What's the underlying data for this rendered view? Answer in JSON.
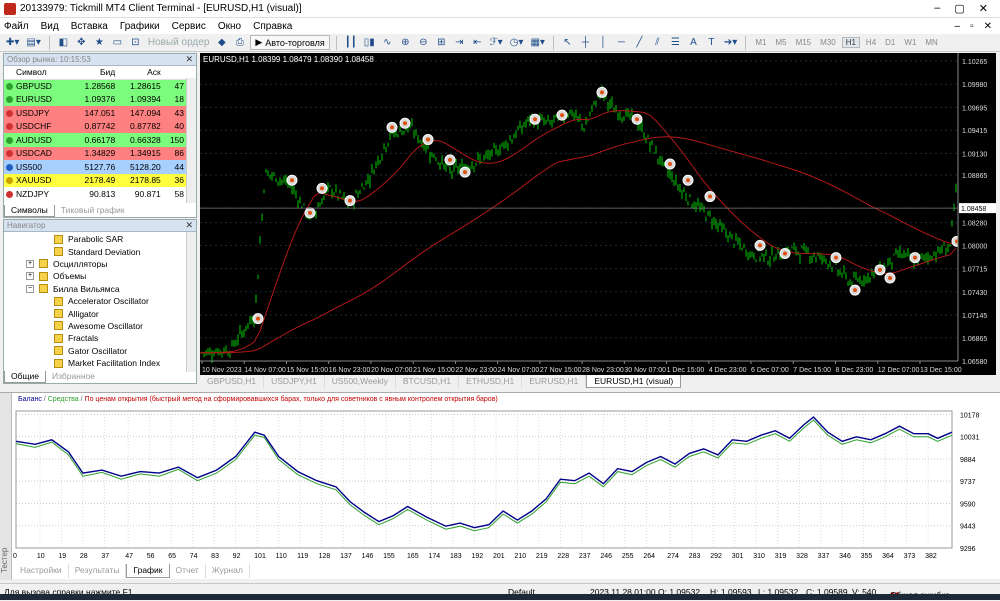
{
  "titlebar": {
    "title": "20133979: Tickmill MT4 Client Terminal - [EURUSD,H1 (visual)]",
    "controls": [
      "–",
      "▢",
      "✕"
    ]
  },
  "menu": {
    "items": [
      "Файл",
      "Вид",
      "Вставка",
      "Графики",
      "Сервис",
      "Окно",
      "Справка"
    ],
    "mdi": [
      "–",
      "▫",
      "✕"
    ]
  },
  "toolbar": {
    "new_order": "Новый ордер",
    "autotrade": "Авто-торговля",
    "timeframes": [
      "M1",
      "M5",
      "M15",
      "M30",
      "H1",
      "H4",
      "D1",
      "W1",
      "MN"
    ],
    "active_timeframe": "H1"
  },
  "market_watch": {
    "title": "Обзор рынка: 10:15:53",
    "columns": [
      "Символ",
      "Бид",
      "Аск",
      ""
    ],
    "rows": [
      {
        "symbol": "GBPUSD",
        "bid": "1.28568",
        "ask": "1.28615",
        "spread": "47",
        "bg": "#7cfc7c",
        "dot": "#2ea02e"
      },
      {
        "symbol": "EURUSD",
        "bid": "1.09376",
        "ask": "1.09394",
        "spread": "18",
        "bg": "#7cfc7c",
        "dot": "#2ea02e"
      },
      {
        "symbol": "USDJPY",
        "bid": "147.051",
        "ask": "147.094",
        "spread": "43",
        "bg": "#ff8080",
        "dot": "#d03030"
      },
      {
        "symbol": "USDCHF",
        "bid": "0.87742",
        "ask": "0.87782",
        "spread": "40",
        "bg": "#ff8080",
        "dot": "#d03030"
      },
      {
        "symbol": "AUDUSD",
        "bid": "0.66178",
        "ask": "0.66328",
        "spread": "150",
        "bg": "#7cfc7c",
        "dot": "#2ea02e"
      },
      {
        "symbol": "USDCAD",
        "bid": "1.34829",
        "ask": "1.34915",
        "spread": "86",
        "bg": "#ff8080",
        "dot": "#d03030"
      },
      {
        "symbol": "US500",
        "bid": "5127.76",
        "ask": "5128.20",
        "spread": "44",
        "bg": "#a8d0ff",
        "dot": "#2060c0"
      },
      {
        "symbol": "XAUUSD",
        "bid": "2178.49",
        "ask": "2178.85",
        "spread": "36",
        "bg": "#ffff40",
        "dot": "#c8a000"
      },
      {
        "symbol": "NZDJPY",
        "bid": "90.813",
        "ask": "90.871",
        "spread": "58",
        "bg": "#ffffff",
        "dot": "#d03030"
      }
    ],
    "tabs": [
      "Символы",
      "Тиковый график"
    ]
  },
  "navigator": {
    "title": "Навигатор",
    "items": [
      {
        "label": "Parabolic SAR",
        "indent": 3,
        "type": "ind"
      },
      {
        "label": "Standard Deviation",
        "indent": 3,
        "type": "ind"
      },
      {
        "label": "Осцилляторы",
        "indent": 1,
        "type": "folder"
      },
      {
        "label": "Объемы",
        "indent": 1,
        "type": "folder"
      },
      {
        "label": "Билла Вильямса",
        "indent": 1,
        "type": "folder-open"
      },
      {
        "label": "Accelerator Oscillator",
        "indent": 3,
        "type": "ind"
      },
      {
        "label": "Alligator",
        "indent": 3,
        "type": "ind"
      },
      {
        "label": "Awesome Oscillator",
        "indent": 3,
        "type": "ind"
      },
      {
        "label": "Fractals",
        "indent": 3,
        "type": "ind"
      },
      {
        "label": "Gator Oscillator",
        "indent": 3,
        "type": "ind"
      },
      {
        "label": "Market Facilitation Index",
        "indent": 3,
        "type": "ind"
      }
    ],
    "tabs": [
      "Общие",
      "Избранное"
    ]
  },
  "chart": {
    "header": "EURUSD,H1  1.08399 1.08479 1.08390 1.08458",
    "price_labels": [
      "1.10265",
      "1.09980",
      "1.09695",
      "1.09415",
      "1.09130",
      "1.08865",
      "1.08458",
      "1.08280",
      "1.08000",
      "1.07715",
      "1.07430",
      "1.07145",
      "1.06865",
      "1.06580"
    ],
    "current_price": "1.08458",
    "time_labels": [
      "10 Nov 2023",
      "14 Nov 07:00",
      "15 Nov 15:00",
      "16 Nov 23:00",
      "20 Nov 07:00",
      "21 Nov 15:00",
      "22 Nov 23:00",
      "24 Nov 07:00",
      "27 Nov 15:00",
      "28 Nov 23:00",
      "30 Nov 07:00",
      "1 Dec 15:00",
      "4 Dec 23:00",
      "6 Dec 07:00",
      "7 Dec 15:00",
      "8 Dec 23:00",
      "12 Dec 07:00",
      "13 Dec 15:00"
    ],
    "tabs": [
      "GBPUSD,H1",
      "USDJPY,H1",
      "US500,Weekly",
      "BTCUSD,H1",
      "ETHUSD,H1",
      "EURUSD,H1",
      "EURUSD,H1 (visual)"
    ],
    "active_tab": "EURUSD,H1 (visual)"
  },
  "tester": {
    "side_label": "Тестер",
    "legend_balance": "Баланс",
    "legend_equity": "Средства",
    "legend_note": "По ценам открытия (быстрый метод на сформировавшихся барах, только для советников с явным контролем открытия баров)",
    "tabs": [
      "Настройки",
      "Результаты",
      "График",
      "Отчет",
      "Журнал"
    ],
    "active_tab": "График"
  },
  "chart_data": {
    "type": "line",
    "title": "",
    "x_ticks": [
      "0",
      "10",
      "19",
      "28",
      "37",
      "47",
      "56",
      "65",
      "74",
      "83",
      "92",
      "101",
      "110",
      "119",
      "128",
      "137",
      "146",
      "155",
      "165",
      "174",
      "183",
      "192",
      "201",
      "210",
      "219",
      "228",
      "237",
      "246",
      "255",
      "264",
      "274",
      "283",
      "292",
      "301",
      "310",
      "319",
      "328",
      "337",
      "346",
      "355",
      "364",
      "373",
      "382"
    ],
    "y_ticks": [
      "10178",
      "10031",
      "9884",
      "9737",
      "9590",
      "9443",
      "9296"
    ],
    "ylim": [
      9296,
      10200
    ],
    "xlim": [
      0,
      392
    ],
    "series": [
      {
        "name": "Баланс",
        "color": "#00008b",
        "x": [
          0,
          8,
          15,
          22,
          28,
          36,
          44,
          52,
          60,
          68,
          76,
          84,
          92,
          100,
          104,
          110,
          118,
          126,
          134,
          140,
          146,
          152,
          158,
          164,
          172,
          180,
          186,
          192,
          198,
          204,
          210,
          216,
          222,
          228,
          234,
          240,
          246,
          252,
          258,
          264,
          270,
          276,
          282,
          288,
          294,
          300,
          306,
          312,
          318,
          324,
          330,
          334,
          340,
          346,
          352,
          358,
          364,
          370,
          376,
          382,
          386,
          392
        ],
        "y": [
          10000,
          9980,
          10010,
          9930,
          9790,
          9810,
          9770,
          9800,
          9790,
          9830,
          9760,
          9810,
          9900,
          10060,
          10040,
          9900,
          9800,
          9740,
          9700,
          9600,
          9530,
          9470,
          9510,
          9570,
          9500,
          9440,
          9460,
          9430,
          9450,
          9540,
          9480,
          9540,
          9620,
          9750,
          9740,
          9790,
          9720,
          9820,
          9800,
          9860,
          9900,
          9850,
          9920,
          9950,
          9910,
          10010,
          10000,
          10040,
          10070,
          10020,
          10110,
          10160,
          10060,
          10000,
          10030,
          10010,
          10050,
          10100,
          10050,
          10050,
          10020,
          10060
        ]
      },
      {
        "name": "Средства",
        "color": "#2ea02e",
        "x": [
          0,
          8,
          15,
          22,
          28,
          36,
          44,
          52,
          60,
          68,
          76,
          84,
          92,
          100,
          104,
          110,
          118,
          126,
          134,
          140,
          146,
          152,
          158,
          164,
          172,
          180,
          186,
          192,
          198,
          204,
          210,
          216,
          222,
          228,
          234,
          240,
          246,
          252,
          258,
          264,
          270,
          276,
          282,
          288,
          294,
          300,
          306,
          312,
          318,
          324,
          330,
          334,
          340,
          346,
          352,
          358,
          364,
          370,
          376,
          382,
          386,
          392
        ],
        "y": [
          9985,
          9960,
          9995,
          9910,
          9770,
          9795,
          9750,
          9785,
          9770,
          9815,
          9740,
          9790,
          9880,
          10040,
          10025,
          9880,
          9780,
          9720,
          9680,
          9580,
          9510,
          9450,
          9490,
          9550,
          9480,
          9420,
          9440,
          9410,
          9430,
          9520,
          9460,
          9520,
          9600,
          9730,
          9720,
          9770,
          9700,
          9800,
          9780,
          9840,
          9880,
          9830,
          9900,
          9930,
          9890,
          9990,
          9980,
          10020,
          10050,
          10000,
          10090,
          10140,
          10040,
          9980,
          10010,
          9990,
          10030,
          10080,
          10030,
          10030,
          10000,
          10040
        ]
      }
    ]
  },
  "status": {
    "help": "Для вызова справки нажмите F1",
    "profile": "Default",
    "datetime": "2023.11.28 01:00",
    "open": "O: 1.09532",
    "high": "H: 1.09593",
    "low": "L: 1.09532",
    "close": "C: 1.09589",
    "volume": "V: 540",
    "error": "Общая ошибка"
  }
}
